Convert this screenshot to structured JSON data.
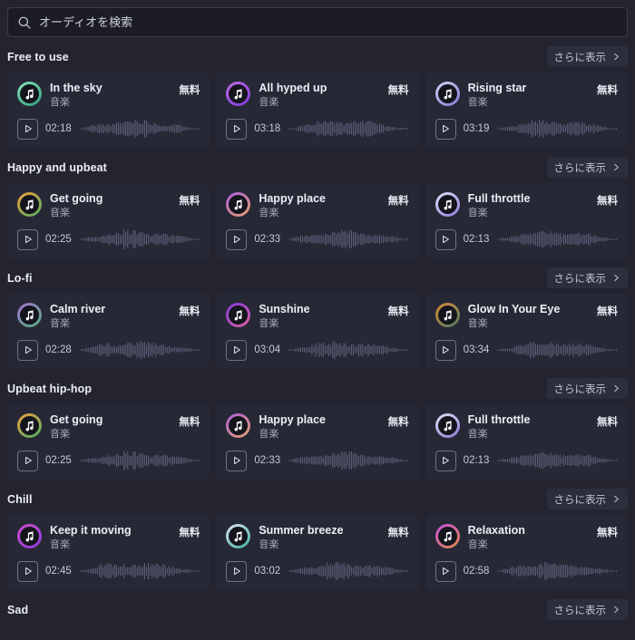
{
  "search": {
    "placeholder": "オーディオを検索",
    "value": "",
    "icon": "search-icon"
  },
  "more_label": "さらに表示",
  "badge_label": "無料",
  "subtitle_label": "音楽",
  "colors": {
    "page_bg": "#23242f",
    "card_bg": "#272836",
    "search_bg": "#1b1c26",
    "more_btn_bg": "#2c2e3b",
    "text_primary": "#eceef4",
    "text_secondary": "#a9acbb",
    "wave": "#5d6079",
    "outline": "#6e7287"
  },
  "sections": [
    {
      "title": "Free to use",
      "tracks": [
        {
          "title": "In the sky",
          "subtitle": "音楽",
          "badge": "無料",
          "duration": "02:18",
          "grad": [
            "#86e3b6",
            "#2f9e7e"
          ],
          "seed": 11
        },
        {
          "title": "All hyped up",
          "subtitle": "音楽",
          "badge": "無料",
          "duration": "03:18",
          "grad": [
            "#c06ce8",
            "#7b3bd6"
          ],
          "seed": 23
        },
        {
          "title": "Rising star",
          "subtitle": "音楽",
          "badge": "無料",
          "duration": "03:19",
          "grad": [
            "#cfd4f5",
            "#7f7ad4"
          ],
          "seed": 37
        }
      ]
    },
    {
      "title": "Happy and upbeat",
      "tracks": [
        {
          "title": "Get going",
          "subtitle": "音楽",
          "badge": "無料",
          "duration": "02:25",
          "grad": [
            "#f2a03c",
            "#4fae63"
          ],
          "seed": 5
        },
        {
          "title": "Happy place",
          "subtitle": "音楽",
          "badge": "無料",
          "duration": "02:33",
          "grad": [
            "#b05ce0",
            "#e0a06a"
          ],
          "seed": 19
        },
        {
          "title": "Full throttle",
          "subtitle": "音楽",
          "badge": "無料",
          "duration": "02:13",
          "grad": [
            "#e0e4f8",
            "#8e7ad8"
          ],
          "seed": 29
        }
      ]
    },
    {
      "title": "Lo-fi",
      "tracks": [
        {
          "title": "Calm river",
          "subtitle": "音楽",
          "badge": "無料",
          "duration": "02:28",
          "grad": [
            "#a96fd8",
            "#4fae7a"
          ],
          "seed": 41
        },
        {
          "title": "Sunshine",
          "subtitle": "音楽",
          "badge": "無料",
          "duration": "03:04",
          "grad": [
            "#7d3ad6",
            "#e05fa8"
          ],
          "seed": 53
        },
        {
          "title": "Glow In Your Eye",
          "subtitle": "音楽",
          "badge": "無料",
          "duration": "03:34",
          "grad": [
            "#e08a3c",
            "#4a7d5e"
          ],
          "seed": 61
        }
      ]
    },
    {
      "title": "Upbeat hip-hop",
      "tracks": [
        {
          "title": "Get going",
          "subtitle": "音楽",
          "badge": "無料",
          "duration": "02:25",
          "grad": [
            "#f2a03c",
            "#4fae63"
          ],
          "seed": 5
        },
        {
          "title": "Happy place",
          "subtitle": "音楽",
          "badge": "無料",
          "duration": "02:33",
          "grad": [
            "#b05ce0",
            "#e0a06a"
          ],
          "seed": 19
        },
        {
          "title": "Full throttle",
          "subtitle": "音楽",
          "badge": "無料",
          "duration": "02:13",
          "grad": [
            "#e0e4f8",
            "#8e7ad8"
          ],
          "seed": 29
        }
      ]
    },
    {
      "title": "Chill",
      "tracks": [
        {
          "title": "Keep it moving",
          "subtitle": "音楽",
          "badge": "無料",
          "duration": "02:45",
          "grad": [
            "#d14fd1",
            "#8e3ad6"
          ],
          "seed": 71
        },
        {
          "title": "Summer breeze",
          "subtitle": "音楽",
          "badge": "無料",
          "duration": "03:02",
          "grad": [
            "#dfe3f7",
            "#3fb39b"
          ],
          "seed": 83
        },
        {
          "title": "Relaxation",
          "subtitle": "音楽",
          "badge": "無料",
          "duration": "02:58",
          "grad": [
            "#c44fe0",
            "#e08a4a"
          ],
          "seed": 97
        }
      ]
    },
    {
      "title": "Sad",
      "tracks": []
    }
  ]
}
